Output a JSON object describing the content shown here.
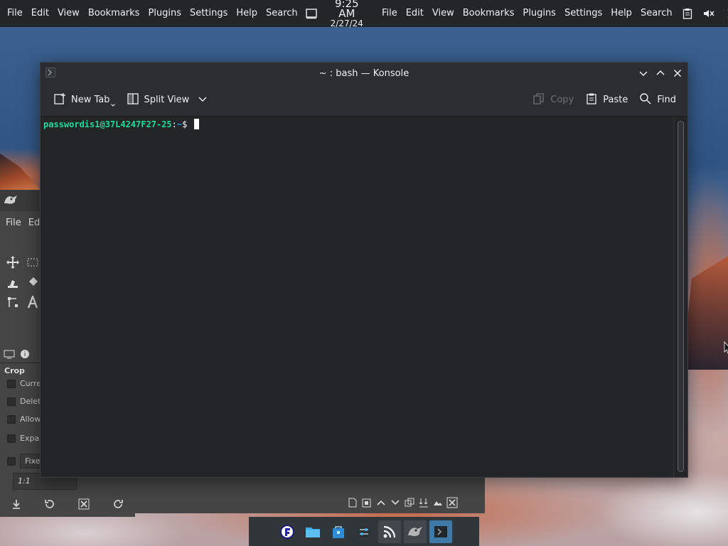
{
  "top_panel": {
    "menu_left": [
      "File",
      "Edit",
      "View",
      "Bookmarks",
      "Plugins",
      "Settings",
      "Help",
      "Search"
    ],
    "clock": {
      "time": "9:25 AM",
      "date": "2/27/24"
    },
    "menu_right": [
      "File",
      "Edit",
      "View",
      "Bookmarks",
      "Plugins",
      "Settings",
      "Help",
      "Search"
    ],
    "tray_icons": [
      "clipboard-icon",
      "volume-muted-icon",
      "expand-icon"
    ]
  },
  "konsole": {
    "title": "~ : bash — Konsole",
    "toolbar": {
      "new_tab": "New Tab",
      "split_view": "Split View",
      "copy": "Copy",
      "paste": "Paste",
      "find": "Find"
    },
    "terminal": {
      "user_host": "passwordis1@37L4247F27-25",
      "separator": ":",
      "path": "~",
      "symbol": "$"
    }
  },
  "gimp": {
    "menu": [
      "File",
      "Ed"
    ],
    "tool_options_title": "Crop",
    "options": [
      "Curre",
      "Delet",
      "Allow",
      "Expa",
      "Fixe"
    ],
    "ratio": "1:1"
  },
  "taskbar": {
    "items": [
      "app-launcher-icon",
      "file-manager-icon",
      "software-store-icon",
      "system-settings-icon",
      "rss-reader-icon",
      "gimp-icon",
      "konsole-icon"
    ]
  },
  "colors": {
    "panel_bg": "#232629",
    "terminal_bg": "#232627",
    "prompt_user": "#1cdc9a",
    "prompt_path": "#1d99f3",
    "active_task": "#3d7aa8"
  }
}
